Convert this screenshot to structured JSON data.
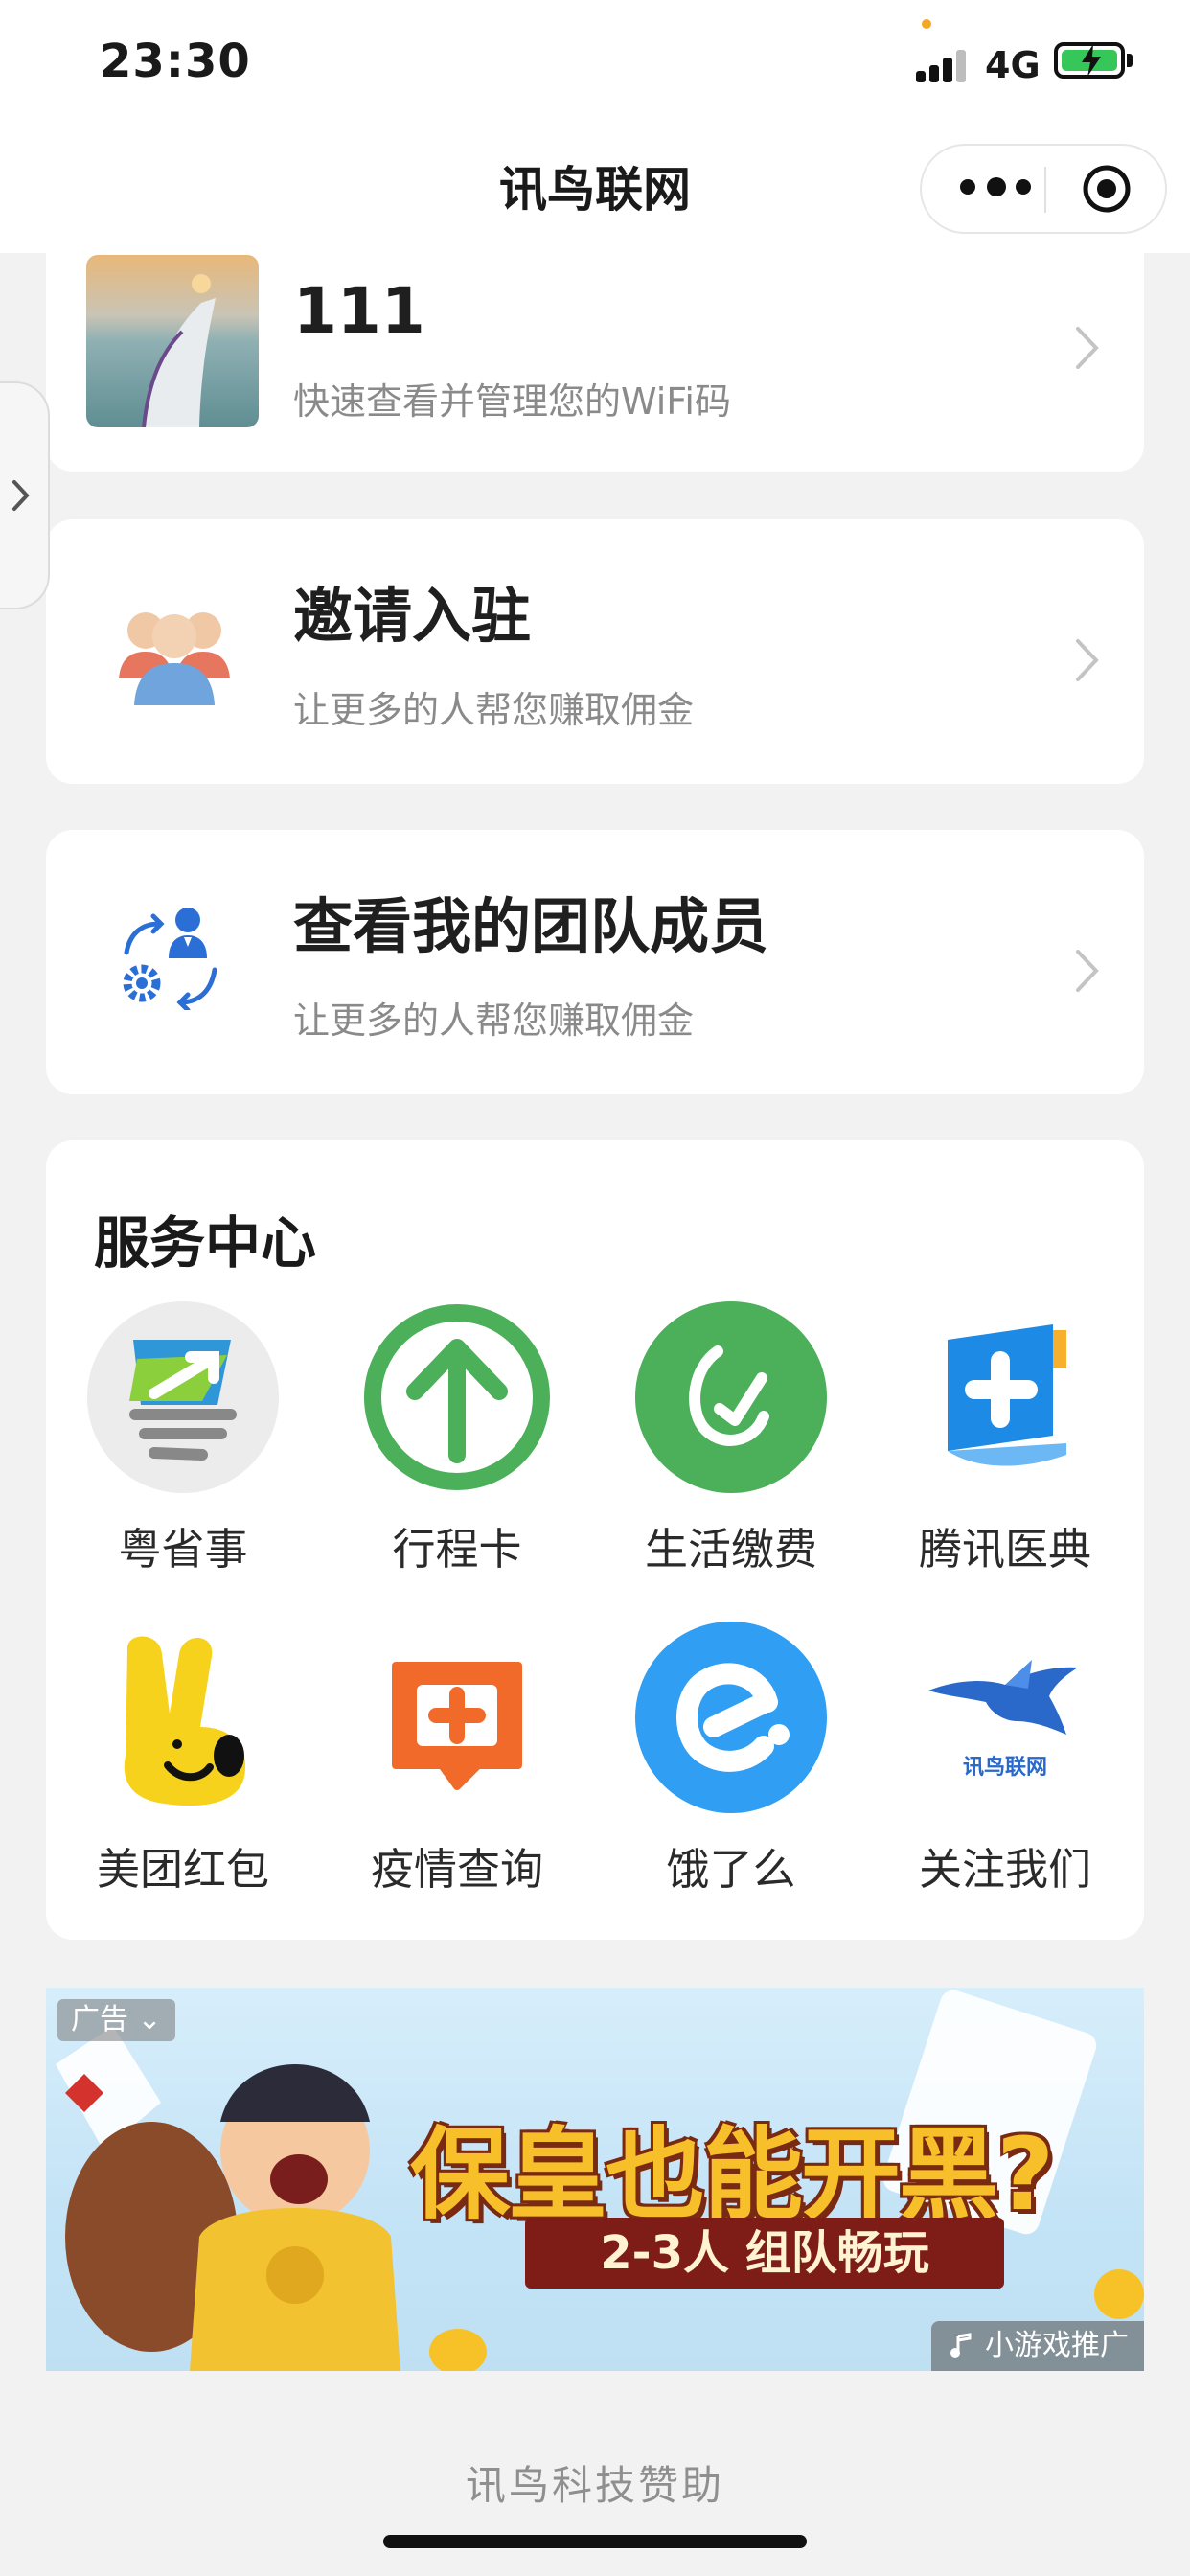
{
  "status_bar": {
    "time": "23:30",
    "network": "4G",
    "battery_color": "#35c759"
  },
  "nav": {
    "title": "讯鸟联网"
  },
  "wifi_card": {
    "title": "111",
    "subtitle": "快速查看并管理您的WiFi码"
  },
  "invite_card": {
    "title": "邀请入驻",
    "subtitle": "让更多的人帮您赚取佣金"
  },
  "team_card": {
    "title": "查看我的团队成员",
    "subtitle": "让更多的人帮您赚取佣金"
  },
  "services": {
    "title": "服务中心",
    "items": [
      {
        "label": "粤省事",
        "icon": "yueshengshi-icon"
      },
      {
        "label": "行程卡",
        "icon": "arrow-up-circle-icon"
      },
      {
        "label": "生活缴费",
        "icon": "payment-check-icon"
      },
      {
        "label": "腾讯医典",
        "icon": "medical-book-icon"
      },
      {
        "label": "美团红包",
        "icon": "meituan-rabbit-icon"
      },
      {
        "label": "疫情查询",
        "icon": "medical-chat-icon"
      },
      {
        "label": "饿了么",
        "icon": "eleme-icon"
      },
      {
        "label": "关注我们",
        "icon": "xunniao-bird-icon"
      }
    ]
  },
  "ad": {
    "tag": "广告",
    "headline": "保皇也能开黑?",
    "ribbon": "2-3人 组队畅玩",
    "corner": "小游戏推广"
  },
  "footer": {
    "text": "讯鸟科技赞助"
  },
  "colors": {
    "green": "#4caf5a",
    "blue": "#2f8fe8",
    "orange": "#f26a2a",
    "yellow": "#f7d21c"
  }
}
